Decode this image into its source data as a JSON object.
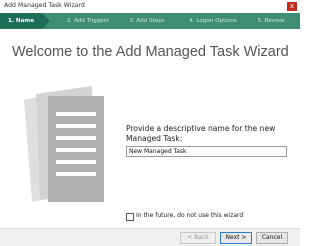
{
  "window": {
    "title": "Add Managed Task Wizard",
    "close_label": "x"
  },
  "steps": [
    {
      "label": "1.  Name"
    },
    {
      "label": "2.  Add Triggers"
    },
    {
      "label": "3.  Add Steps"
    },
    {
      "label": "4.  Logon Options"
    },
    {
      "label": "5.  Review"
    }
  ],
  "active_step": 1,
  "main": {
    "heading": "Welcome to the Add Managed Task Wizard",
    "description": "Provide a descriptive name for the new Managed Task:",
    "name_value": "New Managed Task",
    "icon": "document-icon"
  },
  "options": {
    "skip_wizard_label": "In the future, do not use this wizard",
    "skip_wizard_checked": false
  },
  "buttons": {
    "back": "< Back",
    "next": "Next >",
    "cancel": "Cancel"
  },
  "colors": {
    "stepbar": "#3e8d74",
    "active_step": "#1f6e57",
    "close": "#c42b1c"
  }
}
